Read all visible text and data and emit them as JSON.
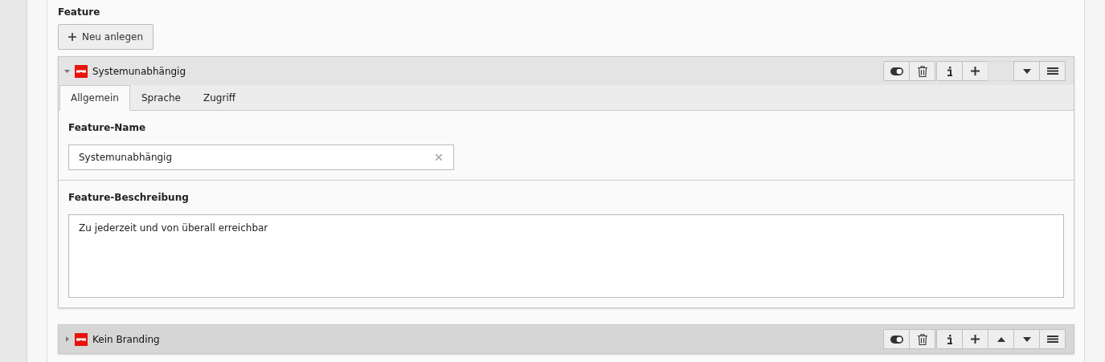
{
  "section": {
    "title": "Feature",
    "new_button": "Neu anlegen"
  },
  "records": [
    {
      "title": "Systemunabhängig",
      "expanded": true,
      "buttons": [
        {
          "kind": "toggle"
        },
        {
          "kind": "delete"
        },
        {
          "kind": "info"
        },
        {
          "kind": "add"
        },
        {
          "kind": "spacer"
        },
        {
          "kind": "down"
        },
        {
          "kind": "drag"
        }
      ],
      "tabs": [
        {
          "label": "Allgemein",
          "selected": true
        },
        {
          "label": "Sprache",
          "selected": false
        },
        {
          "label": "Zugriff",
          "selected": false
        }
      ],
      "fields": [
        {
          "kind": "input",
          "label": "Feature-Name",
          "value": "Systemunabhängig"
        },
        {
          "kind": "textarea",
          "label": "Feature-Beschreibung",
          "value": "Zu jederzeit und von überall erreichbar"
        }
      ]
    },
    {
      "title": "Kein Branding",
      "expanded": false,
      "buttons": [
        {
          "kind": "toggle"
        },
        {
          "kind": "delete"
        },
        {
          "kind": "info"
        },
        {
          "kind": "add"
        },
        {
          "kind": "up"
        },
        {
          "kind": "down"
        },
        {
          "kind": "drag"
        }
      ]
    }
  ]
}
